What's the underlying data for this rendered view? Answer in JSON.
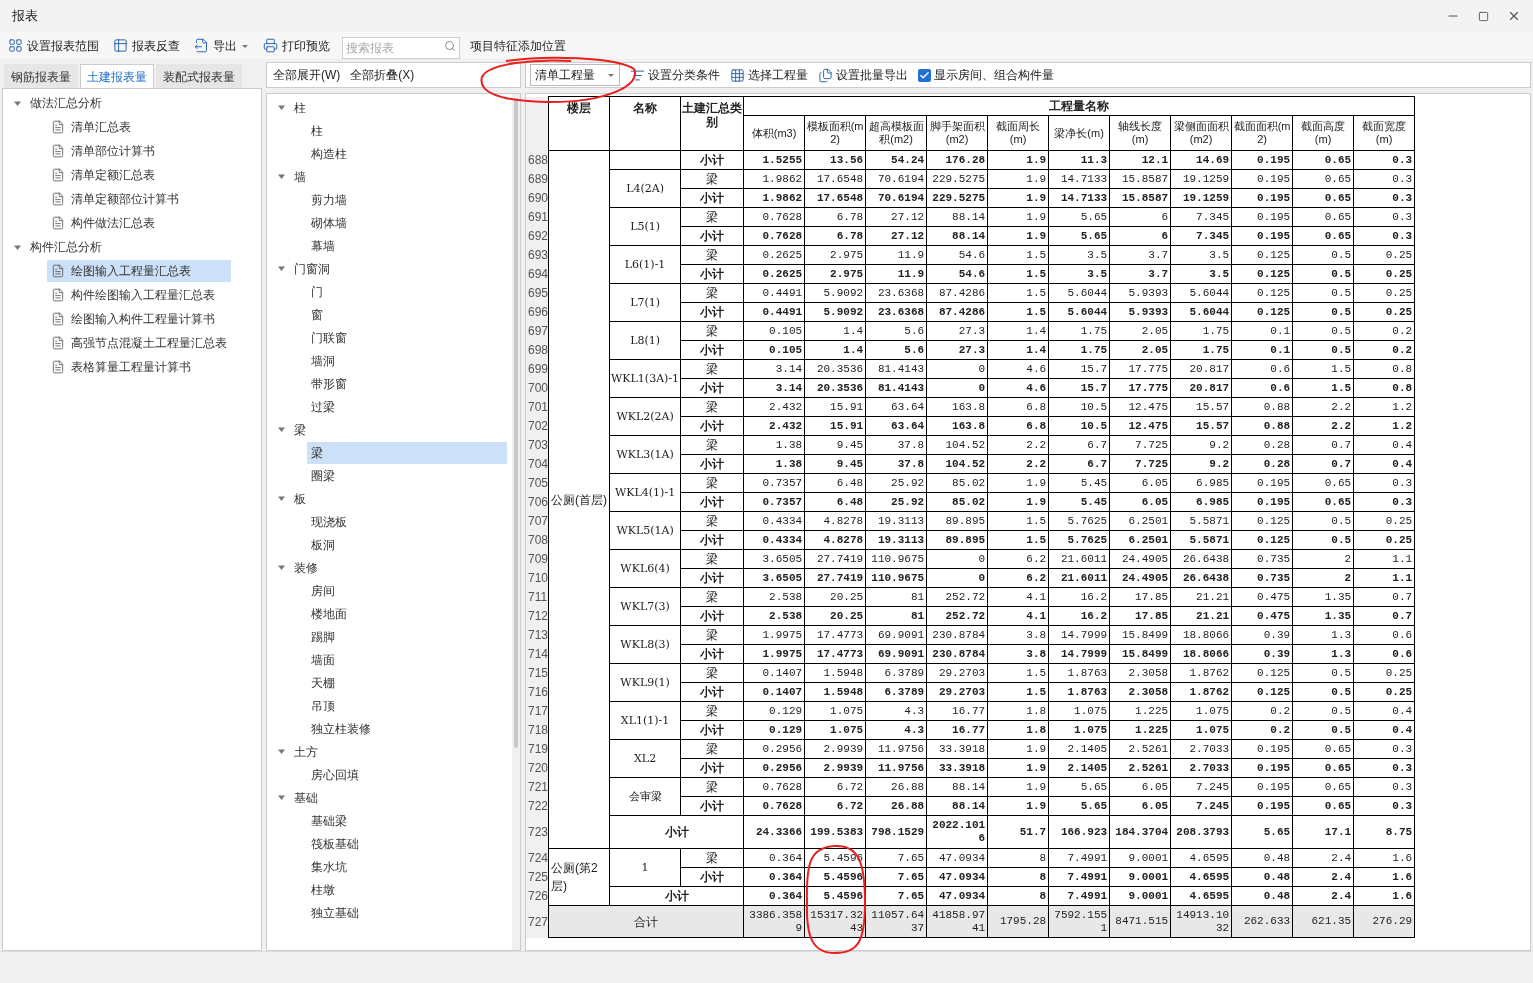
{
  "window": {
    "title": "报表"
  },
  "toolbar": {
    "buttons": [
      "设置报表范围",
      "报表反查",
      "导出",
      "打印预览"
    ],
    "search": {
      "placeholder": "搜索报表"
    },
    "extra_label": "项目特征添加位置"
  },
  "report_tabs": [
    {
      "label": "钢筋报表量",
      "selected": false
    },
    {
      "label": "土建报表量",
      "selected": true
    },
    {
      "label": "装配式报表量",
      "selected": false
    }
  ],
  "report_tree": [
    {
      "label": "做法汇总分析",
      "expanded": true,
      "children": [
        {
          "label": "清单汇总表",
          "selected": false
        },
        {
          "label": "清单部位计算书",
          "selected": false
        },
        {
          "label": "清单定额汇总表",
          "selected": false
        },
        {
          "label": "清单定额部位计算书",
          "selected": false
        },
        {
          "label": "构件做法汇总表",
          "selected": false
        }
      ]
    },
    {
      "label": "构件汇总分析",
      "expanded": true,
      "children": [
        {
          "label": "绘图输入工程量汇总表",
          "selected": true
        },
        {
          "label": "构件绘图输入工程量汇总表",
          "selected": false
        },
        {
          "label": "绘图输入构件工程量计算书",
          "selected": false
        },
        {
          "label": "高强节点混凝土工程量汇总表",
          "selected": false
        },
        {
          "label": "表格算量工程量计算书",
          "selected": false
        }
      ]
    }
  ],
  "component_toolbar": [
    "全部展开(W)",
    "全部折叠(X)"
  ],
  "component_tree": [
    {
      "label": "柱",
      "expanded": true,
      "children": [
        {
          "label": "柱",
          "selected": false
        },
        {
          "label": "构造柱",
          "selected": false
        }
      ]
    },
    {
      "label": "墙",
      "expanded": true,
      "children": [
        {
          "label": "剪力墙",
          "selected": false
        },
        {
          "label": "砌体墙",
          "selected": false
        },
        {
          "label": "幕墙",
          "selected": false
        }
      ]
    },
    {
      "label": "门窗洞",
      "expanded": true,
      "children": [
        {
          "label": "门",
          "selected": false
        },
        {
          "label": "窗",
          "selected": false
        },
        {
          "label": "门联窗",
          "selected": false
        },
        {
          "label": "墙洞",
          "selected": false
        },
        {
          "label": "带形窗",
          "selected": false
        },
        {
          "label": "过梁",
          "selected": false
        }
      ]
    },
    {
      "label": "梁",
      "expanded": true,
      "children": [
        {
          "label": "梁",
          "selected": true
        },
        {
          "label": "圈梁",
          "selected": false
        }
      ]
    },
    {
      "label": "板",
      "expanded": true,
      "children": [
        {
          "label": "现浇板",
          "selected": false
        },
        {
          "label": "板洞",
          "selected": false
        }
      ]
    },
    {
      "label": "装修",
      "expanded": true,
      "children": [
        {
          "label": "房间",
          "selected": false
        },
        {
          "label": "楼地面",
          "selected": false
        },
        {
          "label": "踢脚",
          "selected": false
        },
        {
          "label": "墙面",
          "selected": false
        },
        {
          "label": "天棚",
          "selected": false
        },
        {
          "label": "吊顶",
          "selected": false
        },
        {
          "label": "独立柱装修",
          "selected": false
        }
      ]
    },
    {
      "label": "土方",
      "expanded": true,
      "children": [
        {
          "label": "房心回填",
          "selected": false
        }
      ]
    },
    {
      "label": "基础",
      "expanded": true,
      "children": [
        {
          "label": "基础梁",
          "selected": false
        },
        {
          "label": "筏板基础",
          "selected": false
        },
        {
          "label": "集水坑",
          "selected": false
        },
        {
          "label": "柱墩",
          "selected": false
        },
        {
          "label": "独立基础",
          "selected": false
        }
      ]
    }
  ],
  "table_toolbar": {
    "dropdown": "清单工程量",
    "buttons": [
      "设置分类条件",
      "选择工程量",
      "设置批量导出"
    ],
    "checkbox": {
      "label": "显示房间、组合构件量",
      "checked": true
    }
  },
  "table": {
    "headers": [
      "楼层",
      "名称",
      "土建汇总类别"
    ],
    "group_header": "工程量名称",
    "columns": [
      "体积(m3)",
      "模板面积(m2)",
      "超高模板面积(m2)",
      "脚手架面积(m2)",
      "截面周长(m)",
      "梁净长(m)",
      "轴线长度(m)",
      "梁侧面面积(m2)",
      "截面面积(m2)",
      "截面高度(m)",
      "截面宽度(m)"
    ],
    "floors": [
      {
        "name": "公厕(首层)",
        "groups": [
          {
            "rows": [
              {
                "row": "688",
                "kind": "subtotal",
                "category": "小计",
                "values": [
                  "1.5255",
                  "13.56",
                  "54.24",
                  "176.28",
                  "1.9",
                  "11.3",
                  "12.1",
                  "14.69",
                  "0.195",
                  "0.65",
                  "0.3"
                ]
              }
            ]
          },
          {
            "name": "L4(2A)",
            "rows": [
              {
                "row": "689",
                "kind": "item",
                "category": "梁",
                "values": [
                  "1.9862",
                  "17.6548",
                  "70.6194",
                  "229.5275",
                  "1.9",
                  "14.7133",
                  "15.8587",
                  "19.1259",
                  "0.195",
                  "0.65",
                  "0.3"
                ]
              },
              {
                "row": "690",
                "kind": "subtotal",
                "category": "小计",
                "values": [
                  "1.9862",
                  "17.6548",
                  "70.6194",
                  "229.5275",
                  "1.9",
                  "14.7133",
                  "15.8587",
                  "19.1259",
                  "0.195",
                  "0.65",
                  "0.3"
                ]
              }
            ]
          },
          {
            "name": "L5(1)",
            "rows": [
              {
                "row": "691",
                "kind": "item",
                "category": "梁",
                "values": [
                  "0.7628",
                  "6.78",
                  "27.12",
                  "88.14",
                  "1.9",
                  "5.65",
                  "6",
                  "7.345",
                  "0.195",
                  "0.65",
                  "0.3"
                ]
              },
              {
                "row": "692",
                "kind": "subtotal",
                "category": "小计",
                "values": [
                  "0.7628",
                  "6.78",
                  "27.12",
                  "88.14",
                  "1.9",
                  "5.65",
                  "6",
                  "7.345",
                  "0.195",
                  "0.65",
                  "0.3"
                ]
              }
            ]
          },
          {
            "name": "L6(1)-1",
            "rows": [
              {
                "row": "693",
                "kind": "item",
                "category": "梁",
                "values": [
                  "0.2625",
                  "2.975",
                  "11.9",
                  "54.6",
                  "1.5",
                  "3.5",
                  "3.7",
                  "3.5",
                  "0.125",
                  "0.5",
                  "0.25"
                ]
              },
              {
                "row": "694",
                "kind": "subtotal",
                "category": "小计",
                "values": [
                  "0.2625",
                  "2.975",
                  "11.9",
                  "54.6",
                  "1.5",
                  "3.5",
                  "3.7",
                  "3.5",
                  "0.125",
                  "0.5",
                  "0.25"
                ]
              }
            ]
          },
          {
            "name": "L7(1)",
            "rows": [
              {
                "row": "695",
                "kind": "item",
                "category": "梁",
                "values": [
                  "0.4491",
                  "5.9092",
                  "23.6368",
                  "87.4286",
                  "1.5",
                  "5.6044",
                  "5.9393",
                  "5.6044",
                  "0.125",
                  "0.5",
                  "0.25"
                ]
              },
              {
                "row": "696",
                "kind": "subtotal",
                "category": "小计",
                "values": [
                  "0.4491",
                  "5.9092",
                  "23.6368",
                  "87.4286",
                  "1.5",
                  "5.6044",
                  "5.9393",
                  "5.6044",
                  "0.125",
                  "0.5",
                  "0.25"
                ]
              }
            ]
          },
          {
            "name": "L8(1)",
            "rows": [
              {
                "row": "697",
                "kind": "item",
                "category": "梁",
                "values": [
                  "0.105",
                  "1.4",
                  "5.6",
                  "27.3",
                  "1.4",
                  "1.75",
                  "2.05",
                  "1.75",
                  "0.1",
                  "0.5",
                  "0.2"
                ]
              },
              {
                "row": "698",
                "kind": "subtotal",
                "category": "小计",
                "values": [
                  "0.105",
                  "1.4",
                  "5.6",
                  "27.3",
                  "1.4",
                  "1.75",
                  "2.05",
                  "1.75",
                  "0.1",
                  "0.5",
                  "0.2"
                ]
              }
            ]
          },
          {
            "name": "WKL1(3A)-1",
            "rows": [
              {
                "row": "699",
                "kind": "item",
                "category": "梁",
                "values": [
                  "3.14",
                  "20.3536",
                  "81.4143",
                  "0",
                  "4.6",
                  "15.7",
                  "17.775",
                  "20.817",
                  "0.6",
                  "1.5",
                  "0.8"
                ]
              },
              {
                "row": "700",
                "kind": "subtotal",
                "category": "小计",
                "values": [
                  "3.14",
                  "20.3536",
                  "81.4143",
                  "0",
                  "4.6",
                  "15.7",
                  "17.775",
                  "20.817",
                  "0.6",
                  "1.5",
                  "0.8"
                ]
              }
            ]
          },
          {
            "name": "WKL2(2A)",
            "rows": [
              {
                "row": "701",
                "kind": "item",
                "category": "梁",
                "values": [
                  "2.432",
                  "15.91",
                  "63.64",
                  "163.8",
                  "6.8",
                  "10.5",
                  "12.475",
                  "15.57",
                  "0.88",
                  "2.2",
                  "1.2"
                ]
              },
              {
                "row": "702",
                "kind": "subtotal",
                "category": "小计",
                "values": [
                  "2.432",
                  "15.91",
                  "63.64",
                  "163.8",
                  "6.8",
                  "10.5",
                  "12.475",
                  "15.57",
                  "0.88",
                  "2.2",
                  "1.2"
                ]
              }
            ]
          },
          {
            "name": "WKL3(1A)",
            "rows": [
              {
                "row": "703",
                "kind": "item",
                "category": "梁",
                "values": [
                  "1.38",
                  "9.45",
                  "37.8",
                  "104.52",
                  "2.2",
                  "6.7",
                  "7.725",
                  "9.2",
                  "0.28",
                  "0.7",
                  "0.4"
                ]
              },
              {
                "row": "704",
                "kind": "subtotal",
                "category": "小计",
                "values": [
                  "1.38",
                  "9.45",
                  "37.8",
                  "104.52",
                  "2.2",
                  "6.7",
                  "7.725",
                  "9.2",
                  "0.28",
                  "0.7",
                  "0.4"
                ]
              }
            ]
          },
          {
            "name": "WKL4(1)-1",
            "rows": [
              {
                "row": "705",
                "kind": "item",
                "category": "梁",
                "values": [
                  "0.7357",
                  "6.48",
                  "25.92",
                  "85.02",
                  "1.9",
                  "5.45",
                  "6.05",
                  "6.985",
                  "0.195",
                  "0.65",
                  "0.3"
                ]
              },
              {
                "row": "706",
                "kind": "subtotal",
                "category": "小计",
                "values": [
                  "0.7357",
                  "6.48",
                  "25.92",
                  "85.02",
                  "1.9",
                  "5.45",
                  "6.05",
                  "6.985",
                  "0.195",
                  "0.65",
                  "0.3"
                ]
              }
            ]
          },
          {
            "name": "WKL5(1A)",
            "rows": [
              {
                "row": "707",
                "kind": "item",
                "category": "梁",
                "values": [
                  "0.4334",
                  "4.8278",
                  "19.3113",
                  "89.895",
                  "1.5",
                  "5.7625",
                  "6.2501",
                  "5.5871",
                  "0.125",
                  "0.5",
                  "0.25"
                ]
              },
              {
                "row": "708",
                "kind": "subtotal",
                "category": "小计",
                "values": [
                  "0.4334",
                  "4.8278",
                  "19.3113",
                  "89.895",
                  "1.5",
                  "5.7625",
                  "6.2501",
                  "5.5871",
                  "0.125",
                  "0.5",
                  "0.25"
                ]
              }
            ]
          },
          {
            "name": "WKL6(4)",
            "rows": [
              {
                "row": "709",
                "kind": "item",
                "category": "梁",
                "values": [
                  "3.6505",
                  "27.7419",
                  "110.9675",
                  "0",
                  "6.2",
                  "21.6011",
                  "24.4905",
                  "26.6438",
                  "0.735",
                  "2",
                  "1.1"
                ]
              },
              {
                "row": "710",
                "kind": "subtotal",
                "category": "小计",
                "values": [
                  "3.6505",
                  "27.7419",
                  "110.9675",
                  "0",
                  "6.2",
                  "21.6011",
                  "24.4905",
                  "26.6438",
                  "0.735",
                  "2",
                  "1.1"
                ]
              }
            ]
          },
          {
            "name": "WKL7(3)",
            "rows": [
              {
                "row": "711",
                "kind": "item",
                "category": "梁",
                "values": [
                  "2.538",
                  "20.25",
                  "81",
                  "252.72",
                  "4.1",
                  "16.2",
                  "17.85",
                  "21.21",
                  "0.475",
                  "1.35",
                  "0.7"
                ]
              },
              {
                "row": "712",
                "kind": "subtotal",
                "category": "小计",
                "values": [
                  "2.538",
                  "20.25",
                  "81",
                  "252.72",
                  "4.1",
                  "16.2",
                  "17.85",
                  "21.21",
                  "0.475",
                  "1.35",
                  "0.7"
                ]
              }
            ]
          },
          {
            "name": "WKL8(3)",
            "rows": [
              {
                "row": "713",
                "kind": "item",
                "category": "梁",
                "values": [
                  "1.9975",
                  "17.4773",
                  "69.9091",
                  "230.8784",
                  "3.8",
                  "14.7999",
                  "15.8499",
                  "18.8066",
                  "0.39",
                  "1.3",
                  "0.6"
                ]
              },
              {
                "row": "714",
                "kind": "subtotal",
                "category": "小计",
                "values": [
                  "1.9975",
                  "17.4773",
                  "69.9091",
                  "230.8784",
                  "3.8",
                  "14.7999",
                  "15.8499",
                  "18.8066",
                  "0.39",
                  "1.3",
                  "0.6"
                ]
              }
            ]
          },
          {
            "name": "WKL9(1)",
            "rows": [
              {
                "row": "715",
                "kind": "item",
                "category": "梁",
                "values": [
                  "0.1407",
                  "1.5948",
                  "6.3789",
                  "29.2703",
                  "1.5",
                  "1.8763",
                  "2.3058",
                  "1.8762",
                  "0.125",
                  "0.5",
                  "0.25"
                ]
              },
              {
                "row": "716",
                "kind": "subtotal",
                "category": "小计",
                "values": [
                  "0.1407",
                  "1.5948",
                  "6.3789",
                  "29.2703",
                  "1.5",
                  "1.8763",
                  "2.3058",
                  "1.8762",
                  "0.125",
                  "0.5",
                  "0.25"
                ]
              }
            ]
          },
          {
            "name": "XL1(1)-1",
            "rows": [
              {
                "row": "717",
                "kind": "item",
                "category": "梁",
                "values": [
                  "0.129",
                  "1.075",
                  "4.3",
                  "16.77",
                  "1.8",
                  "1.075",
                  "1.225",
                  "1.075",
                  "0.2",
                  "0.5",
                  "0.4"
                ]
              },
              {
                "row": "718",
                "kind": "subtotal",
                "category": "小计",
                "values": [
                  "0.129",
                  "1.075",
                  "4.3",
                  "16.77",
                  "1.8",
                  "1.075",
                  "1.225",
                  "1.075",
                  "0.2",
                  "0.5",
                  "0.4"
                ]
              }
            ]
          },
          {
            "name": "XL2",
            "rows": [
              {
                "row": "719",
                "kind": "item",
                "category": "梁",
                "values": [
                  "0.2956",
                  "2.9939",
                  "11.9756",
                  "33.3918",
                  "1.9",
                  "2.1405",
                  "2.5261",
                  "2.7033",
                  "0.195",
                  "0.65",
                  "0.3"
                ]
              },
              {
                "row": "720",
                "kind": "subtotal",
                "category": "小计",
                "values": [
                  "0.2956",
                  "2.9939",
                  "11.9756",
                  "33.3918",
                  "1.9",
                  "2.1405",
                  "2.5261",
                  "2.7033",
                  "0.195",
                  "0.65",
                  "0.3"
                ]
              }
            ]
          },
          {
            "name": "会审梁",
            "rows": [
              {
                "row": "721",
                "kind": "item",
                "category": "梁",
                "values": [
                  "0.7628",
                  "6.72",
                  "26.88",
                  "88.14",
                  "1.9",
                  "5.65",
                  "6.05",
                  "7.245",
                  "0.195",
                  "0.65",
                  "0.3"
                ]
              },
              {
                "row": "722",
                "kind": "subtotal",
                "category": "小计",
                "values": [
                  "0.7628",
                  "6.72",
                  "26.88",
                  "88.14",
                  "1.9",
                  "5.65",
                  "6.05",
                  "7.245",
                  "0.195",
                  "0.65",
                  "0.3"
                ]
              }
            ]
          }
        ],
        "subtotal": {
          "row": "723",
          "label": "小计",
          "values": [
            "24.3366",
            "199.5383",
            "798.1529",
            "2022.1016",
            "51.7",
            "166.923",
            "184.3704",
            "208.3793",
            "5.65",
            "17.1",
            "8.75"
          ]
        }
      },
      {
        "name": "公厕(第2层)",
        "groups": [
          {
            "name": "1",
            "rows": [
              {
                "row": "724",
                "kind": "item",
                "category": "梁",
                "values": [
                  "0.364",
                  "5.4596",
                  "7.65",
                  "47.0934",
                  "8",
                  "7.4991",
                  "9.0001",
                  "4.6595",
                  "0.48",
                  "2.4",
                  "1.6"
                ]
              },
              {
                "row": "725",
                "kind": "subtotal",
                "category": "小计",
                "values": [
                  "0.364",
                  "5.4596",
                  "7.65",
                  "47.0934",
                  "8",
                  "7.4991",
                  "9.0001",
                  "4.6595",
                  "0.48",
                  "2.4",
                  "1.6"
                ]
              }
            ]
          }
        ],
        "subtotal": {
          "row": "726",
          "label": "小计",
          "values": [
            "0.364",
            "5.4596",
            "7.65",
            "47.0934",
            "8",
            "7.4991",
            "9.0001",
            "4.6595",
            "0.48",
            "2.4",
            "1.6"
          ]
        }
      }
    ],
    "total": {
      "row": "727",
      "label": "合计",
      "values": [
        "3386.3589",
        "15317.3243",
        "11057.6437",
        "41858.9741",
        "1795.28",
        "7592.1551",
        "8471.515",
        "14913.1032",
        "262.633",
        "621.35",
        "276.29"
      ]
    }
  }
}
